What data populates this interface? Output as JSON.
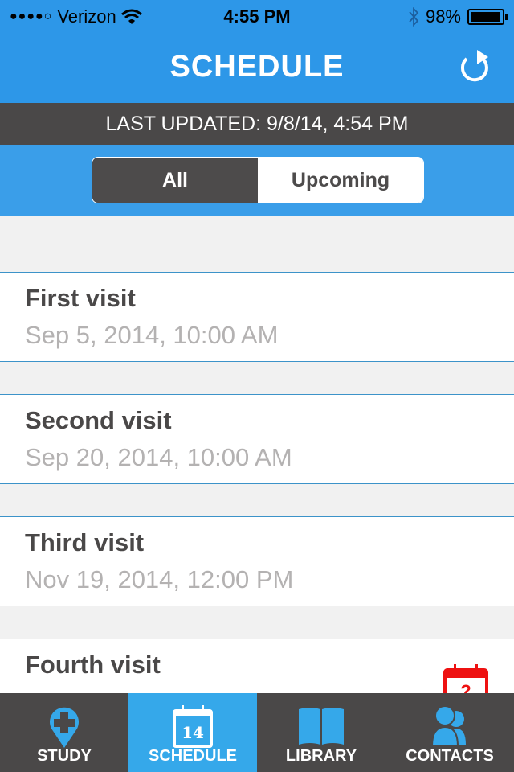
{
  "status_bar": {
    "signal": "●●●●○",
    "carrier": "Verizon",
    "time": "4:55 PM",
    "battery_percent": "98%",
    "battery_level": 0.98
  },
  "header": {
    "title": "SCHEDULE",
    "refresh_icon": "refresh-icon"
  },
  "last_updated": "LAST UPDATED: 9/8/14, 4:54 PM",
  "filter": {
    "options": [
      "All",
      "Upcoming"
    ],
    "selected": "All"
  },
  "visits": [
    {
      "name": "First visit",
      "date": "Sep 5, 2014, 10:00 AM"
    },
    {
      "name": "Second visit",
      "date": "Sep 20, 2014, 10:00 AM"
    },
    {
      "name": "Third visit",
      "date": "Nov 19, 2014, 12:00 PM"
    },
    {
      "name": "Fourth visit",
      "date": "",
      "status_icon": "calendar-question-icon"
    }
  ],
  "colors": {
    "primary_blue": "#2d97e8",
    "dark_gray": "#4a4848",
    "active_tab": "#35a8ea",
    "warning_red": "#ee1111"
  },
  "tabs": [
    {
      "label": "STUDY",
      "icon": "location-cross-icon",
      "active": false
    },
    {
      "label": "SCHEDULE",
      "icon": "calendar-icon",
      "badge": "14",
      "active": true
    },
    {
      "label": "LIBRARY",
      "icon": "book-icon",
      "active": false
    },
    {
      "label": "CONTACTS",
      "icon": "contacts-icon",
      "active": false
    }
  ]
}
